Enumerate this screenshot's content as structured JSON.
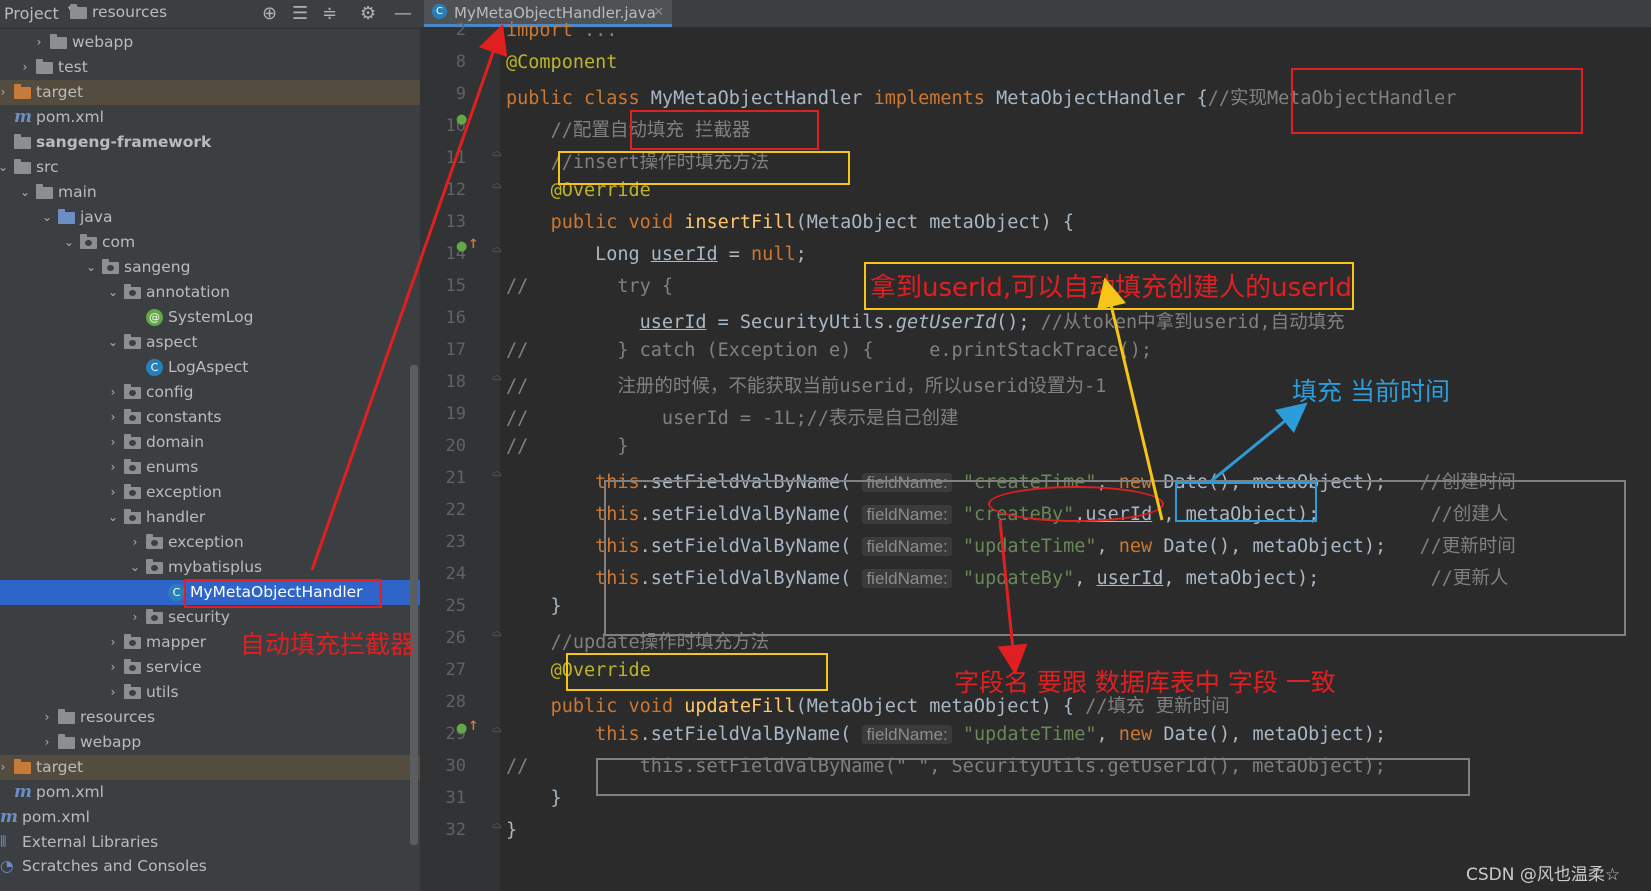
{
  "sidebar": {
    "title": "Project",
    "rows": [
      {
        "label": "resources",
        "type": "folder"
      },
      {
        "label": "webapp",
        "type": "folder"
      },
      {
        "label": "test",
        "type": "folder"
      },
      {
        "label": "target",
        "type": "folder-orange"
      },
      {
        "label": "pom.xml",
        "type": "maven"
      },
      {
        "label": "sangeng-framework",
        "type": "module"
      },
      {
        "label": "src",
        "type": "folder"
      },
      {
        "label": "main",
        "type": "folder"
      },
      {
        "label": "java",
        "type": "folder-blue"
      },
      {
        "label": "com",
        "type": "package"
      },
      {
        "label": "sangeng",
        "type": "package"
      },
      {
        "label": "annotation",
        "type": "package"
      },
      {
        "label": "SystemLog",
        "type": "annotation"
      },
      {
        "label": "aspect",
        "type": "package"
      },
      {
        "label": "LogAspect",
        "type": "class"
      },
      {
        "label": "config",
        "type": "package"
      },
      {
        "label": "constants",
        "type": "package"
      },
      {
        "label": "domain",
        "type": "package"
      },
      {
        "label": "enums",
        "type": "package"
      },
      {
        "label": "exception",
        "type": "package"
      },
      {
        "label": "handler",
        "type": "package"
      },
      {
        "label": "exception",
        "type": "package"
      },
      {
        "label": "mybatisplus",
        "type": "package"
      },
      {
        "label": "MyMetaObjectHandler",
        "type": "class"
      },
      {
        "label": "security",
        "type": "package"
      },
      {
        "label": "mapper",
        "type": "package"
      },
      {
        "label": "service",
        "type": "package"
      },
      {
        "label": "utils",
        "type": "package"
      },
      {
        "label": "resources",
        "type": "folder"
      },
      {
        "label": "webapp",
        "type": "folder"
      },
      {
        "label": "target",
        "type": "folder-orange"
      },
      {
        "label": "pom.xml",
        "type": "maven"
      },
      {
        "label": "pom.xml",
        "type": "maven"
      },
      {
        "label": "External Libraries",
        "type": "libs"
      },
      {
        "label": "Scratches and Consoles",
        "type": "scratch"
      }
    ]
  },
  "editor": {
    "tab_label": "MyMetaObjectHandler.java",
    "line_numbers": [
      "2",
      "8",
      "9",
      "10",
      "11",
      "12",
      "13",
      "14",
      "15",
      "16",
      "17",
      "18",
      "19",
      "20",
      "21",
      "22",
      "23",
      "24",
      "25",
      "26",
      "27",
      "28",
      "29",
      "30",
      "31",
      "32"
    ]
  },
  "annotations": {
    "class_comment": "//实现MetaObjectHandler",
    "auto_fill_interceptor": "自动填充拦截器",
    "get_userid": "拿到userId,可以自动填充创建人的userId",
    "fill_current_time": "填充 当前时间",
    "field_name_note": "字段名 要跟 数据库表中 字段 一致"
  },
  "watermark": "CSDN @风也温柔☆",
  "colors": {
    "annotation_red": "#e02020",
    "annotation_yellow": "#f5c518",
    "annotation_blue": "#2d9cdb",
    "selection": "#2f65ca"
  }
}
